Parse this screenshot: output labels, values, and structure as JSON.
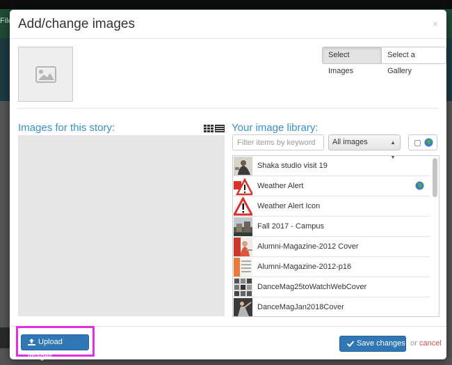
{
  "background": {
    "file_menu": "File"
  },
  "modal": {
    "title": "Add/change images",
    "close": "×"
  },
  "mode_buttons": {
    "select_images": "Select Images",
    "select_gallery": "Select a Gallery"
  },
  "story": {
    "heading": "Images for this story:"
  },
  "library": {
    "heading": "Your image library:",
    "filter_placeholder": "Filter items by keyword",
    "select_value": "All images",
    "items": [
      {
        "name": "Shaka studio visit 19",
        "thumb": "photo-person",
        "shared": false
      },
      {
        "name": "Weather Alert",
        "thumb": "alert-sign-red",
        "shared": true
      },
      {
        "name": "Weather Alert Icon",
        "thumb": "alert-sign",
        "shared": false
      },
      {
        "name": "Fall 2017 - Campus",
        "thumb": "photo-campus",
        "shared": false
      },
      {
        "name": "Alumni-Magazine-2012 Cover",
        "thumb": "photo-magazine",
        "shared": false
      },
      {
        "name": "Alumni-Magazine-2012-p16",
        "thumb": "photo-page",
        "shared": false
      },
      {
        "name": "DanceMag25toWatchWebCover",
        "thumb": "photo-grid",
        "shared": false
      },
      {
        "name": "DanceMagJan2018Cover",
        "thumb": "photo-dance",
        "shared": false
      }
    ]
  },
  "footer": {
    "upload_label": "Upload images",
    "save_label": "Save changes",
    "or_text": "or",
    "cancel_label": "cancel"
  },
  "colors": {
    "accent": "#3a8fcf",
    "primary_button": "#2f78b5",
    "cancel": "#d9534f",
    "highlight": "#e42ee4"
  }
}
